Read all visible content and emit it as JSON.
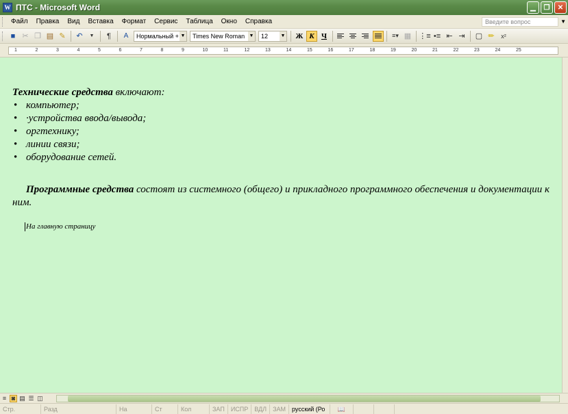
{
  "window": {
    "title": "ПТС - Microsoft Word",
    "app_icon": "word-icon"
  },
  "menu": {
    "items": [
      "Файл",
      "Правка",
      "Вид",
      "Вставка",
      "Формат",
      "Сервис",
      "Таблица",
      "Окно",
      "Справка"
    ],
    "question_placeholder": "Введите вопрос"
  },
  "toolbar": {
    "style_value": "Нормальный + 1",
    "font_value": "Times New Roman",
    "size_value": "12",
    "bold_label": "Ж",
    "italic_label": "К",
    "underline_label": "Ч",
    "superscript_label": "x²"
  },
  "ruler": {
    "numbers": [
      "1",
      "2",
      "3",
      "4",
      "5",
      "6",
      "7",
      "8",
      "9",
      "10",
      "11",
      "12",
      "13",
      "14",
      "15",
      "16",
      "17",
      "18",
      "19",
      "20",
      "21",
      "22",
      "23",
      "24",
      "25"
    ]
  },
  "document": {
    "p1_bold": "Технические средства",
    "p1_rest": " включают:",
    "bullets": [
      "компьютер;",
      "·устройства ввода/вывода;",
      "оргтехнику;",
      "линии связи;",
      "оборудование сетей."
    ],
    "p2_bold": "Программные средства",
    "p2_rest": " состоят из системного (общего) и прикладного программного обеспечения и документации к ним.",
    "link": "На главную страницу"
  },
  "status": {
    "page": "Стр.",
    "section": "Разд",
    "at": "На",
    "line": "Ст",
    "col": "Кол",
    "rec": "ЗАП",
    "trk": "ИСПР",
    "ext": "ВДЛ",
    "ovr": "ЗАМ",
    "lang": "русский (Ро"
  }
}
